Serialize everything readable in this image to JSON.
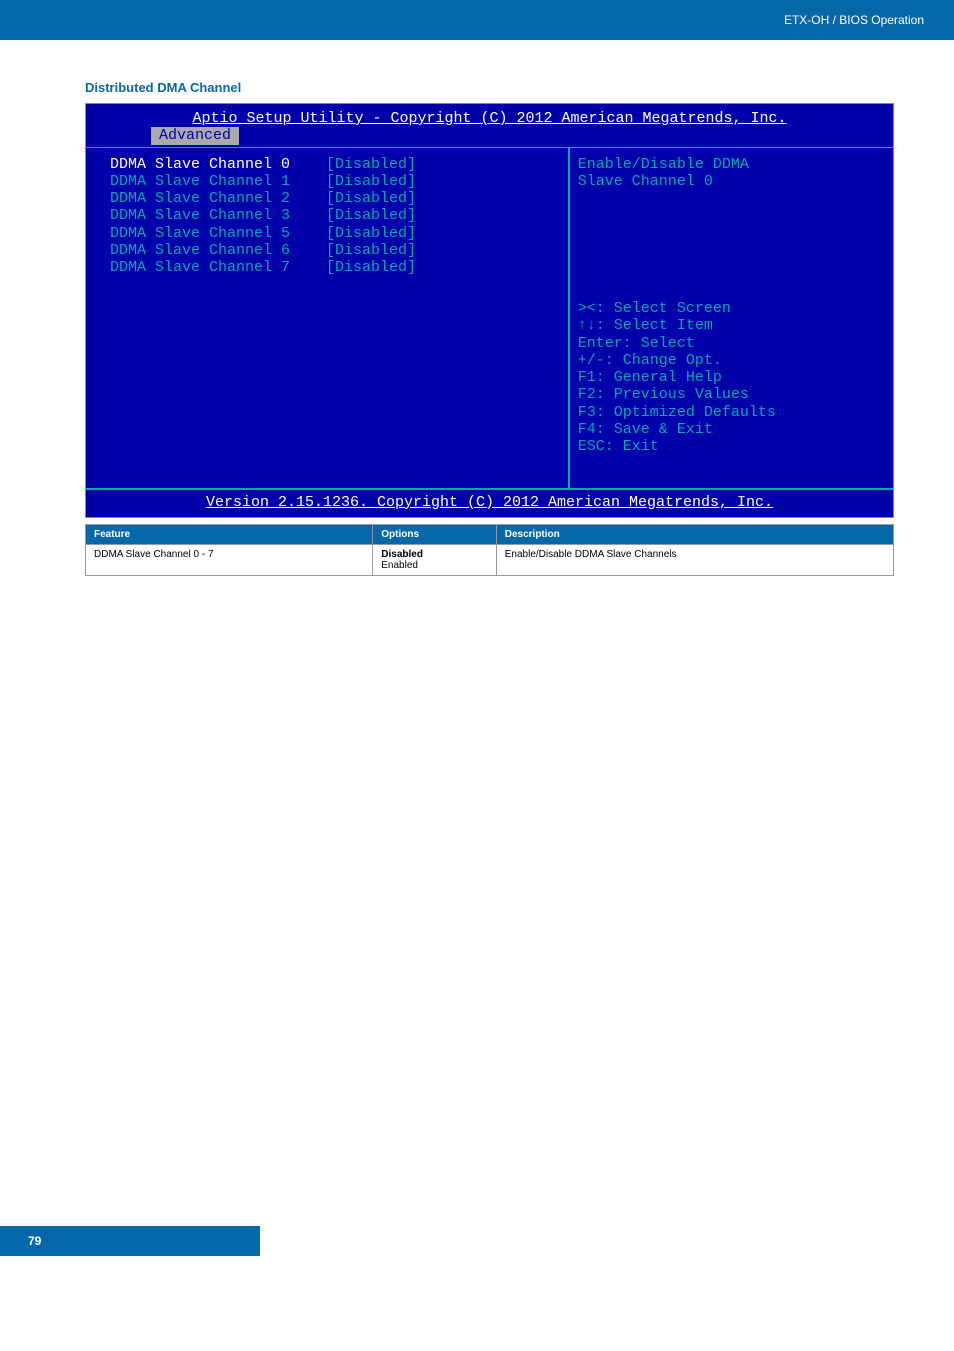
{
  "header": {
    "breadcrumb": "ETX-OH / BIOS Operation"
  },
  "section": {
    "title": "Distributed DMA Channel"
  },
  "bios": {
    "utility_title": "Aptio Setup Utility - Copyright (C) 2012 American Megatrends, Inc.",
    "tab": "Advanced",
    "items": [
      {
        "label": "DDMA Slave Channel 0",
        "value": "[Disabled]",
        "selected": true
      },
      {
        "label": "DDMA Slave Channel 1",
        "value": "[Disabled]",
        "selected": false
      },
      {
        "label": "DDMA Slave Channel 2",
        "value": "[Disabled]",
        "selected": false
      },
      {
        "label": "DDMA Slave Channel 3",
        "value": "[Disabled]",
        "selected": false
      },
      {
        "label": "DDMA Slave Channel 5",
        "value": "[Disabled]",
        "selected": false
      },
      {
        "label": "DDMA Slave Channel 6",
        "value": "[Disabled]",
        "selected": false
      },
      {
        "label": "DDMA Slave Channel 7",
        "value": "[Disabled]",
        "selected": false
      }
    ],
    "help_top_line1": "Enable/Disable DDMA",
    "help_top_line2": "Slave Channel 0",
    "help_keys": [
      "><: Select Screen",
      "↑↓: Select Item",
      "Enter: Select",
      "+/-: Change Opt.",
      "F1: General Help",
      "F2: Previous Values",
      "F3: Optimized Defaults",
      "F4: Save & Exit",
      "ESC: Exit"
    ],
    "footer": "Version 2.15.1236. Copyright (C) 2012 American Megatrends, Inc."
  },
  "table": {
    "headers": {
      "feature": "Feature",
      "options": "Options",
      "description": "Description"
    },
    "row": {
      "feature": "DDMA Slave Channel 0 - 7",
      "option_bold": "Disabled",
      "option_plain": "Enabled",
      "description": "Enable/Disable DDMA Slave Channels"
    }
  },
  "footer": {
    "page": "79"
  }
}
